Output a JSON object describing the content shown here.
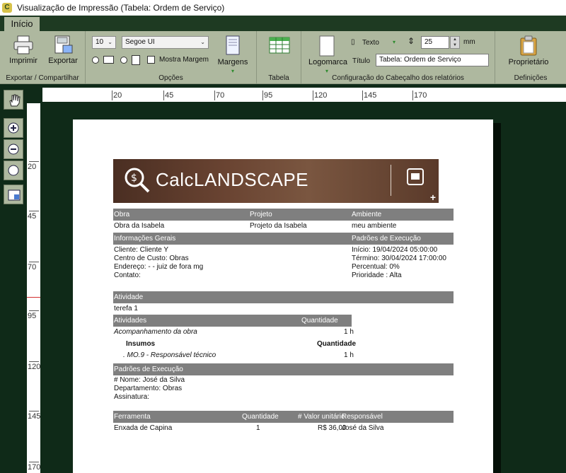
{
  "window": {
    "title": "Visualização de Impressão (Tabela: Ordem de Serviço)"
  },
  "tabs": [
    {
      "label": "Início"
    }
  ],
  "ribbon": {
    "export_group": {
      "label": "Exportar / Compartilhar",
      "print_label": "Imprimir",
      "export_label": "Exportar"
    },
    "options_group": {
      "label": "Opções",
      "font_size": "10",
      "font_name": "Segoe UI",
      "show_margin_label": "Mostra Margem",
      "margins_label": "Margens"
    },
    "table_group": {
      "label": "Tabela"
    },
    "header_group": {
      "label": "Configuração do Cabeçalho dos relatórios",
      "logo_label": "Logomarca",
      "text_label": "Texto",
      "size_value": "25",
      "unit": "mm",
      "title_label": "Título",
      "title_value": "Tabela: Ordem de Serviço"
    },
    "definitions_group": {
      "label": "Definições",
      "owner_label": "Proprietário"
    }
  },
  "left_tools": [
    "hand-tool-icon",
    "zoom-in-icon",
    "zoom-out-icon",
    "zoom-fit-icon",
    "page-view-icon"
  ],
  "ruler": {
    "horizontal": [
      "20",
      "45",
      "70",
      "95",
      "120",
      "145",
      "170"
    ],
    "vertical": [
      "20",
      "45",
      "70",
      "95",
      "120",
      "145",
      "170"
    ]
  },
  "report": {
    "brand": "CalcLANDSCAPE",
    "header1": {
      "obra": "Obra",
      "projeto": "Projeto",
      "ambiente": "Ambiente"
    },
    "row1": {
      "obra": "Obra da Isabela",
      "projeto": "Projeto da Isabela",
      "ambiente": "meu ambiente"
    },
    "header2": {
      "left": "Informações Gerais",
      "right": "Padrões de Execução"
    },
    "info": [
      "Cliente:  Cliente Y",
      "Centro de Custo: Obras",
      "Endereço:  -  - juiz de fora mg",
      "Contato:"
    ],
    "execution": [
      "Início: 19/04/2024 05:00:00",
      "Término: 30/04/2024 17:00:00",
      "Percentual: 0%",
      "Prioridade : Alta"
    ],
    "activity_header": "Atividade",
    "activity_value": "terefa 1",
    "activities_header": {
      "left": "Atividades",
      "right": "Quantidade"
    },
    "activity_row": {
      "name": "Acompanhamento da obra",
      "qty": "1 h"
    },
    "supplies_header": {
      "left": "Insumos",
      "right": "Quantidade"
    },
    "supply_row": {
      "name": ". MO.9 - Responsável técnico",
      "qty": "1 h"
    },
    "exec_header": "Padrões de Execução",
    "exec_lines": [
      "# Nome: José da Silva",
      "Departamento: Obras",
      "Assinatura:"
    ],
    "tools_header": {
      "tool": "Ferramenta",
      "qty": "Quantidade",
      "unit": "# Valor unitáric",
      "resp": "Responsável"
    },
    "tools_row": {
      "tool": "Enxada de Capina",
      "qty": "1",
      "unit": "R$ 36,00",
      "resp": "José da Silva"
    }
  }
}
